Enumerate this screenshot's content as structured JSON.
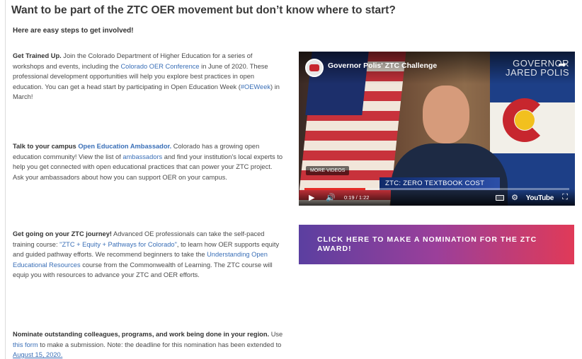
{
  "page": {
    "title": "Want to be part of the ZTC OER movement but don’t know where to start?",
    "subtitle": "Here are easy steps to get involved!"
  },
  "steps": {
    "get_trained": {
      "lead": "Get Trained Up.",
      "text1": " Join the Colorado Department of Higher Education for a series of workshops and events, including the ",
      "link1": "Colorado OER Conference",
      "text2": " in June of 2020. These professional development opportunities will help you explore best practices in open education. You can get a head start by participating in Open Education Week (",
      "link2": "#OEWeek",
      "text3": ") in March!"
    },
    "ambassador": {
      "lead": "Talk to your campus ",
      "lead_link": "Open Education Ambassador.",
      "text1": " Colorado has a growing open education community! View the list of ",
      "link1": "ambassadors",
      "text2": " and find your institution’s local experts to help you get connected with open educational practices that can power your ZTC project. Ask your ambassadors about how you can support OER on your campus."
    },
    "journey": {
      "lead": "Get going on your ZTC journey!",
      "text1": " Advanced OE professionals can take the self-paced training course: ",
      "link1": "\"ZTC + Equity + Pathways for Colorado\"",
      "text2": ", to learn how OER supports equity and guided pathway efforts. We recommend beginners to take the ",
      "link2": "Understanding Open Educational Resources",
      "text3": " course from the Commonwealth of Learning. The ZTC course will equip you with resources to advance your ZTC and OER efforts."
    },
    "nominate": {
      "lead": "Nominate outstanding colleagues, programs, and work being done in your region.",
      "text1": " Use ",
      "link1": "this form",
      "text2": " to make a submission. Note: the deadline for this nomination has been extended to ",
      "link2": "August 15, 2020."
    }
  },
  "video": {
    "title": "Governor Polis' ZTC Challenge",
    "watermark_line1": "GOVERNOR",
    "watermark_line2": "JARED POLIS",
    "more_videos": "MORE VIDEOS",
    "lower_third": "ZTC: ZERO TEXTBOOK COST",
    "time": "0:19 / 1:22",
    "progress": 0.23,
    "youtube_label": "YouTube",
    "icons": [
      "channel-logo",
      "share-icon",
      "play-icon",
      "volume-icon",
      "cc-icon",
      "settings-icon",
      "fullscreen-icon"
    ]
  },
  "nomination_button": {
    "label": "CLICK HERE TO MAKE A NOMINATION FOR THE ZTC AWARD!"
  },
  "colors": {
    "link": "#3a6fb7",
    "button_start": "#5b3fa0",
    "button_end": "#e03a58",
    "progress": "#e52d27"
  }
}
